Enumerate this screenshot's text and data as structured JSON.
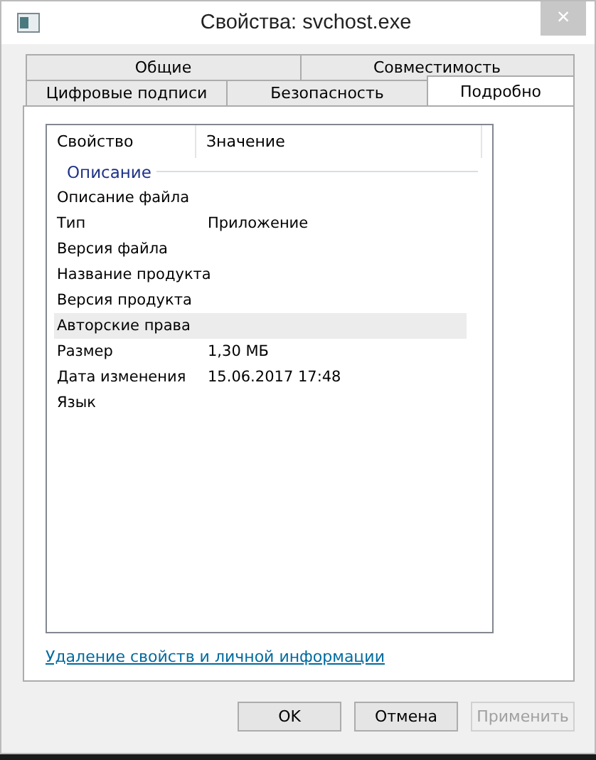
{
  "window": {
    "title": "Свойства: svchost.exe",
    "close": "×"
  },
  "tab_rows": [
    [
      {
        "label": "Общие",
        "selected": false
      },
      {
        "label": "Совместимость",
        "selected": false
      }
    ],
    [
      {
        "label": "Цифровые подписи",
        "selected": false
      },
      {
        "label": "Безопасность",
        "selected": false
      },
      {
        "label": "Подробно",
        "selected": true
      }
    ]
  ],
  "table": {
    "columns": [
      "Свойство",
      "Значение"
    ],
    "group": "Описание",
    "rows": [
      {
        "property": "Описание файла",
        "value": "",
        "selected": false
      },
      {
        "property": "Тип",
        "value": "Приложение",
        "selected": false
      },
      {
        "property": "Версия файла",
        "value": "",
        "selected": false
      },
      {
        "property": "Название продукта",
        "value": "",
        "selected": false
      },
      {
        "property": "Версия продукта",
        "value": "",
        "selected": false
      },
      {
        "property": "Авторские права",
        "value": "",
        "selected": true
      },
      {
        "property": "Размер",
        "value": "1,30 МБ",
        "selected": false
      },
      {
        "property": "Дата изменения",
        "value": "15.06.2017 17:48",
        "selected": false
      },
      {
        "property": "Язык",
        "value": "",
        "selected": false
      }
    ]
  },
  "link": "Удаление свойств и личной информации",
  "buttons": [
    {
      "label": "OK",
      "disabled": false
    },
    {
      "label": "Отмена",
      "disabled": false
    },
    {
      "label": "Применить",
      "disabled": true
    }
  ]
}
